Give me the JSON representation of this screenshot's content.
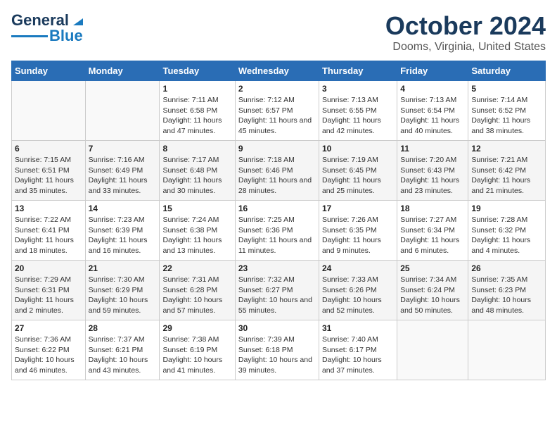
{
  "header": {
    "logo_line1": "General",
    "logo_line2": "Blue",
    "title": "October 2024",
    "subtitle": "Dooms, Virginia, United States"
  },
  "days_of_week": [
    "Sunday",
    "Monday",
    "Tuesday",
    "Wednesday",
    "Thursday",
    "Friday",
    "Saturday"
  ],
  "weeks": [
    [
      {
        "day": "",
        "sunrise": "",
        "sunset": "",
        "daylight": ""
      },
      {
        "day": "",
        "sunrise": "",
        "sunset": "",
        "daylight": ""
      },
      {
        "day": "1",
        "sunrise": "Sunrise: 7:11 AM",
        "sunset": "Sunset: 6:58 PM",
        "daylight": "Daylight: 11 hours and 47 minutes."
      },
      {
        "day": "2",
        "sunrise": "Sunrise: 7:12 AM",
        "sunset": "Sunset: 6:57 PM",
        "daylight": "Daylight: 11 hours and 45 minutes."
      },
      {
        "day": "3",
        "sunrise": "Sunrise: 7:13 AM",
        "sunset": "Sunset: 6:55 PM",
        "daylight": "Daylight: 11 hours and 42 minutes."
      },
      {
        "day": "4",
        "sunrise": "Sunrise: 7:13 AM",
        "sunset": "Sunset: 6:54 PM",
        "daylight": "Daylight: 11 hours and 40 minutes."
      },
      {
        "day": "5",
        "sunrise": "Sunrise: 7:14 AM",
        "sunset": "Sunset: 6:52 PM",
        "daylight": "Daylight: 11 hours and 38 minutes."
      }
    ],
    [
      {
        "day": "6",
        "sunrise": "Sunrise: 7:15 AM",
        "sunset": "Sunset: 6:51 PM",
        "daylight": "Daylight: 11 hours and 35 minutes."
      },
      {
        "day": "7",
        "sunrise": "Sunrise: 7:16 AM",
        "sunset": "Sunset: 6:49 PM",
        "daylight": "Daylight: 11 hours and 33 minutes."
      },
      {
        "day": "8",
        "sunrise": "Sunrise: 7:17 AM",
        "sunset": "Sunset: 6:48 PM",
        "daylight": "Daylight: 11 hours and 30 minutes."
      },
      {
        "day": "9",
        "sunrise": "Sunrise: 7:18 AM",
        "sunset": "Sunset: 6:46 PM",
        "daylight": "Daylight: 11 hours and 28 minutes."
      },
      {
        "day": "10",
        "sunrise": "Sunrise: 7:19 AM",
        "sunset": "Sunset: 6:45 PM",
        "daylight": "Daylight: 11 hours and 25 minutes."
      },
      {
        "day": "11",
        "sunrise": "Sunrise: 7:20 AM",
        "sunset": "Sunset: 6:43 PM",
        "daylight": "Daylight: 11 hours and 23 minutes."
      },
      {
        "day": "12",
        "sunrise": "Sunrise: 7:21 AM",
        "sunset": "Sunset: 6:42 PM",
        "daylight": "Daylight: 11 hours and 21 minutes."
      }
    ],
    [
      {
        "day": "13",
        "sunrise": "Sunrise: 7:22 AM",
        "sunset": "Sunset: 6:41 PM",
        "daylight": "Daylight: 11 hours and 18 minutes."
      },
      {
        "day": "14",
        "sunrise": "Sunrise: 7:23 AM",
        "sunset": "Sunset: 6:39 PM",
        "daylight": "Daylight: 11 hours and 16 minutes."
      },
      {
        "day": "15",
        "sunrise": "Sunrise: 7:24 AM",
        "sunset": "Sunset: 6:38 PM",
        "daylight": "Daylight: 11 hours and 13 minutes."
      },
      {
        "day": "16",
        "sunrise": "Sunrise: 7:25 AM",
        "sunset": "Sunset: 6:36 PM",
        "daylight": "Daylight: 11 hours and 11 minutes."
      },
      {
        "day": "17",
        "sunrise": "Sunrise: 7:26 AM",
        "sunset": "Sunset: 6:35 PM",
        "daylight": "Daylight: 11 hours and 9 minutes."
      },
      {
        "day": "18",
        "sunrise": "Sunrise: 7:27 AM",
        "sunset": "Sunset: 6:34 PM",
        "daylight": "Daylight: 11 hours and 6 minutes."
      },
      {
        "day": "19",
        "sunrise": "Sunrise: 7:28 AM",
        "sunset": "Sunset: 6:32 PM",
        "daylight": "Daylight: 11 hours and 4 minutes."
      }
    ],
    [
      {
        "day": "20",
        "sunrise": "Sunrise: 7:29 AM",
        "sunset": "Sunset: 6:31 PM",
        "daylight": "Daylight: 11 hours and 2 minutes."
      },
      {
        "day": "21",
        "sunrise": "Sunrise: 7:30 AM",
        "sunset": "Sunset: 6:29 PM",
        "daylight": "Daylight: 10 hours and 59 minutes."
      },
      {
        "day": "22",
        "sunrise": "Sunrise: 7:31 AM",
        "sunset": "Sunset: 6:28 PM",
        "daylight": "Daylight: 10 hours and 57 minutes."
      },
      {
        "day": "23",
        "sunrise": "Sunrise: 7:32 AM",
        "sunset": "Sunset: 6:27 PM",
        "daylight": "Daylight: 10 hours and 55 minutes."
      },
      {
        "day": "24",
        "sunrise": "Sunrise: 7:33 AM",
        "sunset": "Sunset: 6:26 PM",
        "daylight": "Daylight: 10 hours and 52 minutes."
      },
      {
        "day": "25",
        "sunrise": "Sunrise: 7:34 AM",
        "sunset": "Sunset: 6:24 PM",
        "daylight": "Daylight: 10 hours and 50 minutes."
      },
      {
        "day": "26",
        "sunrise": "Sunrise: 7:35 AM",
        "sunset": "Sunset: 6:23 PM",
        "daylight": "Daylight: 10 hours and 48 minutes."
      }
    ],
    [
      {
        "day": "27",
        "sunrise": "Sunrise: 7:36 AM",
        "sunset": "Sunset: 6:22 PM",
        "daylight": "Daylight: 10 hours and 46 minutes."
      },
      {
        "day": "28",
        "sunrise": "Sunrise: 7:37 AM",
        "sunset": "Sunset: 6:21 PM",
        "daylight": "Daylight: 10 hours and 43 minutes."
      },
      {
        "day": "29",
        "sunrise": "Sunrise: 7:38 AM",
        "sunset": "Sunset: 6:19 PM",
        "daylight": "Daylight: 10 hours and 41 minutes."
      },
      {
        "day": "30",
        "sunrise": "Sunrise: 7:39 AM",
        "sunset": "Sunset: 6:18 PM",
        "daylight": "Daylight: 10 hours and 39 minutes."
      },
      {
        "day": "31",
        "sunrise": "Sunrise: 7:40 AM",
        "sunset": "Sunset: 6:17 PM",
        "daylight": "Daylight: 10 hours and 37 minutes."
      },
      {
        "day": "",
        "sunrise": "",
        "sunset": "",
        "daylight": ""
      },
      {
        "day": "",
        "sunrise": "",
        "sunset": "",
        "daylight": ""
      }
    ]
  ]
}
